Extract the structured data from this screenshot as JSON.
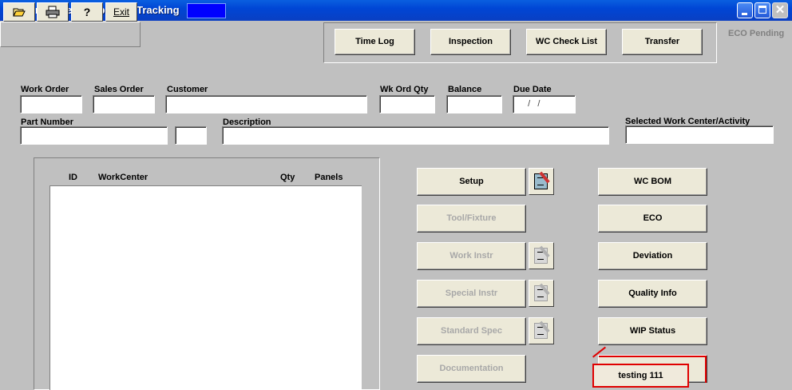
{
  "window": {
    "title": "Work Order Shop Floor Tracking"
  },
  "toolbar": {
    "exit_label": "Exit",
    "help_glyph": "?"
  },
  "top_buttons": {
    "time_log": "Time Log",
    "inspection": "Inspection",
    "wc_check_list": "WC Check List",
    "transfer": "Transfer"
  },
  "eco_pending": "ECO Pending",
  "fields": {
    "work_order": {
      "label": "Work Order",
      "value": ""
    },
    "sales_order": {
      "label": "Sales Order",
      "value": ""
    },
    "customer": {
      "label": "Customer",
      "value": ""
    },
    "wk_ord_qty": {
      "label": "Wk Ord Qty",
      "value": ""
    },
    "balance": {
      "label": "Balance",
      "value": ""
    },
    "due_date": {
      "label": "Due Date",
      "value": "  /   /"
    },
    "part_number": {
      "label": "Part Number",
      "value": ""
    },
    "part_rev": {
      "value": ""
    },
    "description": {
      "label": "Description",
      "value": ""
    },
    "selected_wc": {
      "label": "Selected Work Center/Activity",
      "value": ""
    }
  },
  "list": {
    "columns": [
      "ID",
      "WorkCenter",
      "Qty",
      "Panels"
    ],
    "rows": []
  },
  "mid_buttons": {
    "setup": "Setup",
    "tool_fixture": "Tool/Fixture",
    "work_instr": "Work Instr",
    "special_instr": "Special Instr",
    "standard_spec": "Standard Spec",
    "documentation": "Documentation"
  },
  "right_buttons": {
    "wc_bom": "WC BOM",
    "eco": "ECO",
    "deviation": "Deviation",
    "quality_info": "Quality Info",
    "wip_status": "WIP Status"
  },
  "tooltip_box": {
    "label": "testing 111"
  },
  "colors": {
    "title_bar": "#0046d5",
    "face": "#c0c0c0",
    "button": "#ece9d8",
    "highlight_red": "#e00000"
  }
}
